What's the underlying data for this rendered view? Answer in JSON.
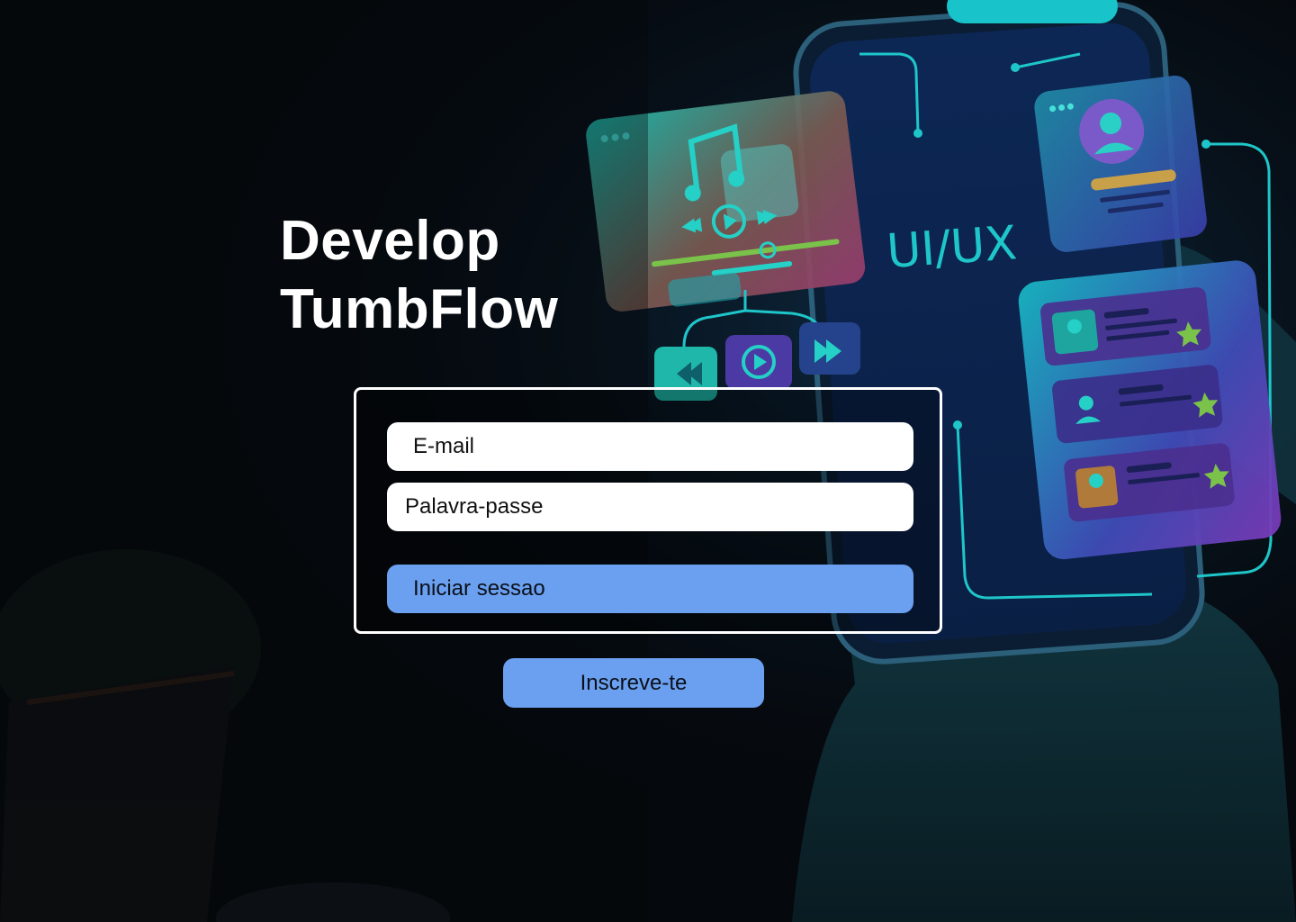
{
  "hero": {
    "title_line1": "Develop",
    "title_line2": "TumbFlow",
    "illustration_text": "UI/UX"
  },
  "login_form": {
    "email_placeholder": "E-mail",
    "password_placeholder": "Palavra-passe",
    "submit_label": "Iniciar sessao"
  },
  "signup": {
    "label": "Inscreve-te"
  },
  "icons": [
    "music-note-icon",
    "play-icon",
    "rewind-icon",
    "fast-forward-icon",
    "user-icon",
    "star-icon"
  ],
  "colors": {
    "button_bg": "#6aa0ef",
    "button_text": "#0b0f18",
    "field_bg": "#ffffff",
    "title": "#ffffff",
    "accent_cyan": "#18c3c9",
    "accent_purple": "#6b3fb2"
  }
}
